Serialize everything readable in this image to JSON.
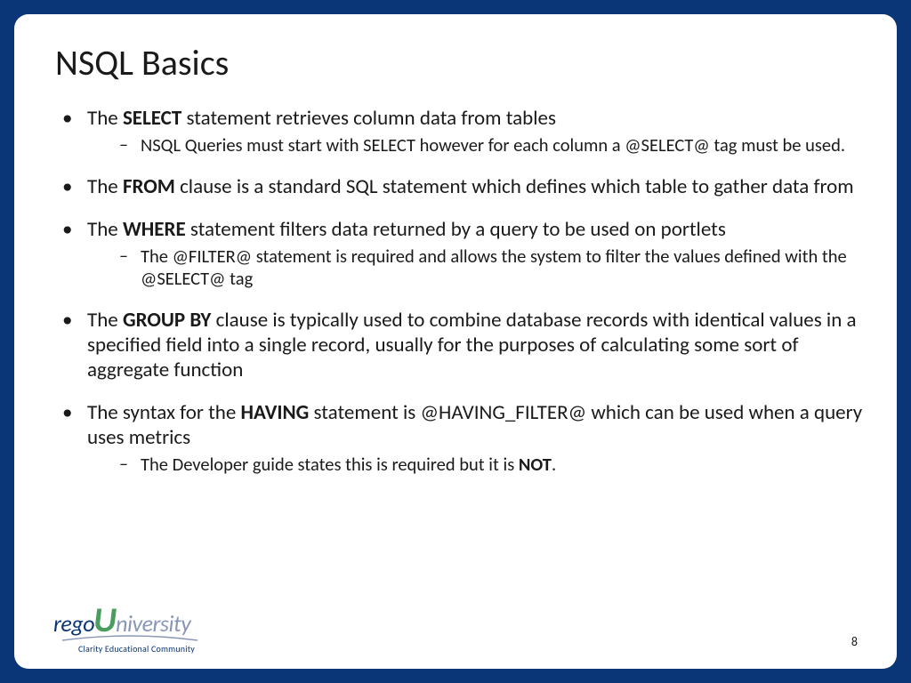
{
  "title": "NSQL Basics",
  "bullets": {
    "b1_pre": "The ",
    "b1_bold": "SELECT",
    "b1_post": " statement retrieves column data from tables",
    "b1_sub": "NSQL Queries must start with SELECT however for each column a @SELECT@ tag must be used.",
    "b2_pre": "The ",
    "b2_bold": "FROM",
    "b2_post": " clause is a standard SQL statement which defines which table to gather data from",
    "b3_pre": "The ",
    "b3_bold": "WHERE",
    "b3_post": " statement filters data returned by a query to be used on portlets",
    "b3_sub": "The @FILTER@ statement is required and allows the system to filter the values defined with the @SELECT@ tag",
    "b4_pre": "The ",
    "b4_bold": "GROUP BY",
    "b4_post": " clause is typically used to combine database records with identical values in a specified field into a single record, usually for the purposes of calculating some sort of aggregate function",
    "b5_pre": "The syntax for the ",
    "b5_bold": "HAVING",
    "b5_post": " statement is @HAVING_FILTER@ which can be used when a query uses metrics",
    "b5_sub_pre": "The Developer guide states this is required but it is ",
    "b5_sub_bold": "NOT",
    "b5_sub_post": "."
  },
  "logo": {
    "rego": "rego",
    "u": "U",
    "niversity": "niversity",
    "tagline": "Clarity Educational Community"
  },
  "page": "8"
}
